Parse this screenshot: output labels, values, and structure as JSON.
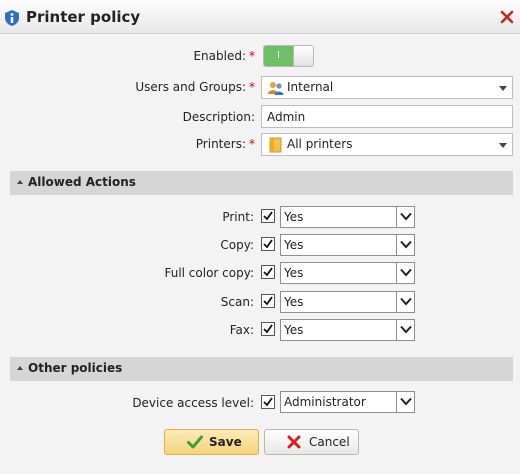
{
  "window": {
    "title": "Printer policy",
    "title_icon": "info-shield-icon",
    "close_icon": "close-icon"
  },
  "form": {
    "enabled": {
      "label": "Enabled:",
      "required": "*",
      "toggle_text": "I",
      "value": "on"
    },
    "users_groups": {
      "label": "Users and Groups:",
      "required": "*",
      "value": "Internal",
      "icon": "users-group-icon"
    },
    "description": {
      "label": "Description:",
      "value": "Admin"
    },
    "printers": {
      "label": "Printers:",
      "required": "*",
      "value": "All printers",
      "icon": "folder-icon"
    }
  },
  "allowed_actions": {
    "title": "Allowed Actions",
    "items": [
      {
        "label": "Print:",
        "checked": true,
        "value": "Yes"
      },
      {
        "label": "Copy:",
        "checked": true,
        "value": "Yes"
      },
      {
        "label": "Full color copy:",
        "checked": true,
        "value": "Yes"
      },
      {
        "label": "Scan:",
        "checked": true,
        "value": "Yes"
      },
      {
        "label": "Fax:",
        "checked": true,
        "value": "Yes"
      }
    ]
  },
  "other_policies": {
    "title": "Other policies",
    "device_access": {
      "label": "Device access level:",
      "checked": true,
      "value": "Administrator"
    }
  },
  "buttons": {
    "save": "Save",
    "cancel": "Cancel"
  },
  "colors": {
    "toggle_on": "#6dc066",
    "required": "#d40000",
    "save_bg": "#f6d37c",
    "cancel_icon": "#d81e1e",
    "save_icon": "#3aa52e"
  }
}
